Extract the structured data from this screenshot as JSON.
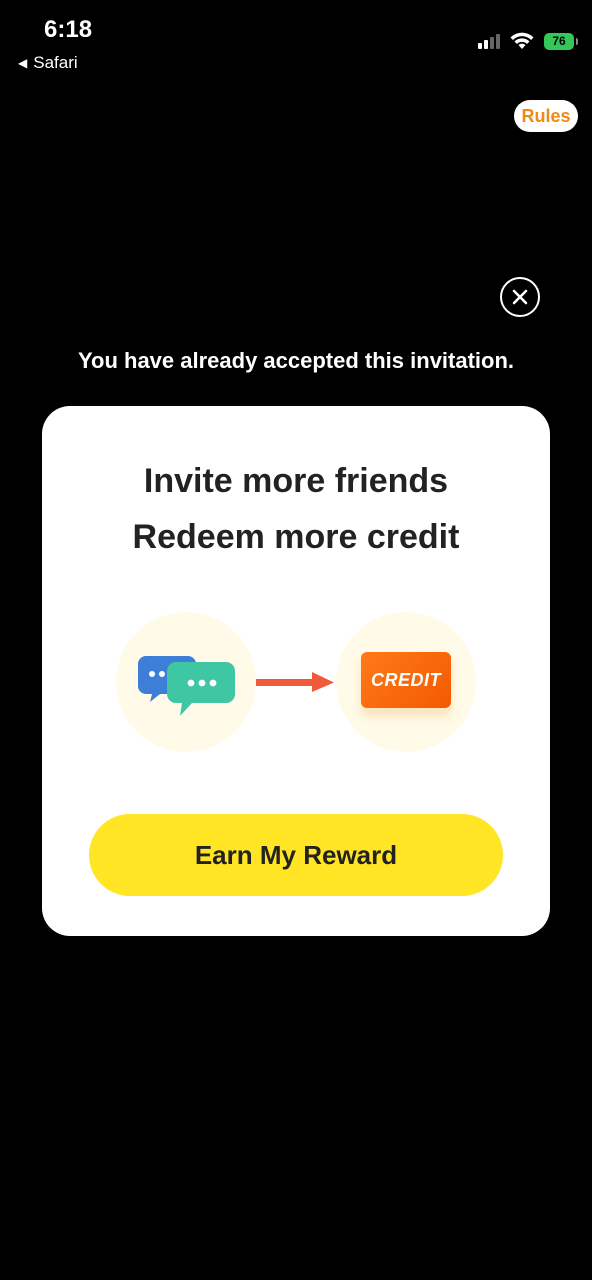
{
  "status_bar": {
    "time": "6:18",
    "back_app": "Safari",
    "battery": "76"
  },
  "header": {
    "rules_label": "Rules"
  },
  "notice": {
    "text": "You have already accepted this invitation."
  },
  "card": {
    "title_line1": "Invite more friends",
    "title_line2": "Redeem more credit",
    "credit_label": "CREDIT",
    "cta_label": "Earn My Reward"
  },
  "colors": {
    "cta": "#ffe524",
    "rules_text": "#f08a12",
    "credit_card": "#f35a00",
    "arrow": "#f0593a",
    "battery": "#34c759"
  },
  "icons": {
    "close": "close-icon",
    "chat": "chat-bubbles-icon",
    "arrow": "arrow-right-icon",
    "wifi": "wifi-icon",
    "signal": "signal-icon",
    "battery": "battery-icon"
  }
}
